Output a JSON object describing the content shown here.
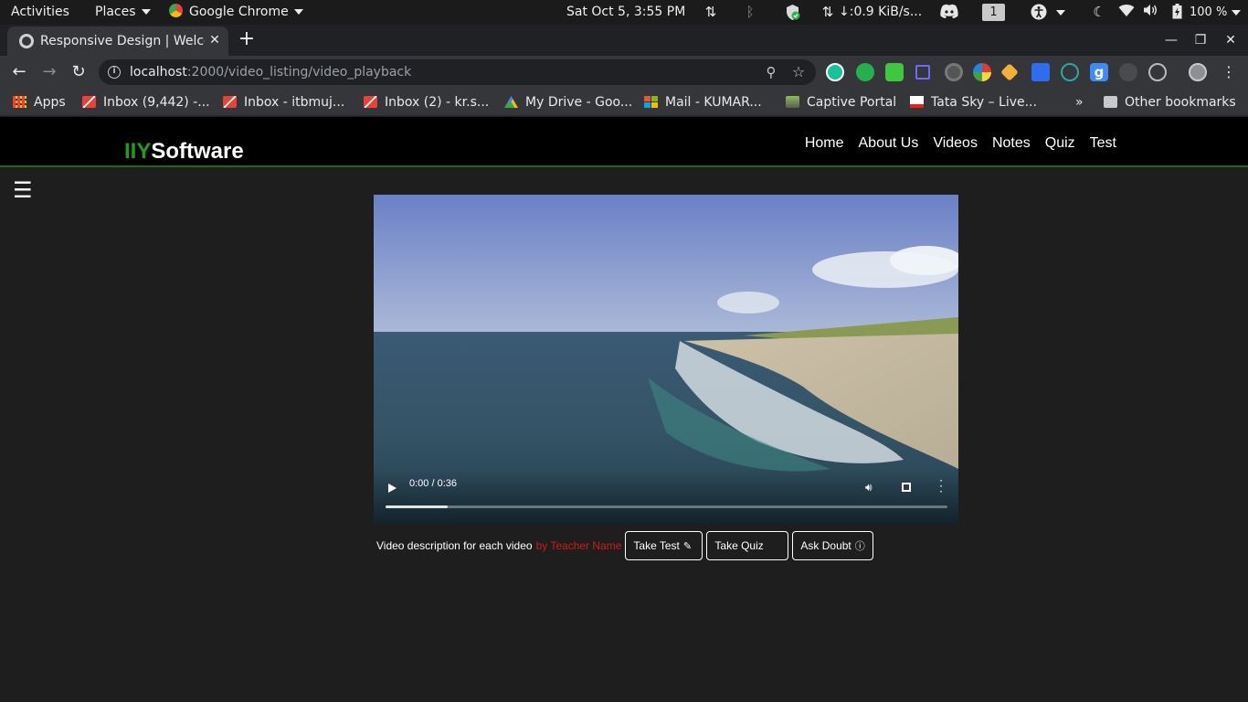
{
  "system_bar": {
    "activities": "Activities",
    "places": "Places",
    "app": "Google Chrome",
    "clock": "Sat Oct  5,  3:55 PM",
    "network_speed": "↓:0.9 KiB/s...",
    "workspace": "1",
    "battery": "100 %"
  },
  "browser": {
    "tab_title": "Responsive Design | Welcome",
    "url_host": "localhost",
    "url_path": ":2000/video_listing/video_playback",
    "bookmarks": [
      {
        "label": "Apps",
        "icon": "apps-grid-icon"
      },
      {
        "label": "Inbox (9,442) -...",
        "icon": "gmail-icon"
      },
      {
        "label": "Inbox - itbmuj...",
        "icon": "gmail-icon"
      },
      {
        "label": "Inbox (2) - kr.s...",
        "icon": "gmail-icon"
      },
      {
        "label": "My Drive - Goo...",
        "icon": "google-drive-icon"
      },
      {
        "label": "Mail - KUMAR...",
        "icon": "microsoft-icon"
      },
      {
        "label": "Captive Portal",
        "icon": "captive-portal-icon"
      },
      {
        "label": "Tata Sky – Live...",
        "icon": "tata-sky-icon"
      }
    ],
    "bookmarks_overflow": "»",
    "other_bookmarks": "Other bookmarks"
  },
  "site": {
    "brand_accent": "IIY",
    "brand_rest": "Software",
    "nav": [
      "Home",
      "About Us",
      "Videos",
      "Notes",
      "Quiz",
      "Test"
    ],
    "accent_color": "#1f9d1f"
  },
  "video": {
    "current_time": "0:00",
    "duration": "0:36",
    "time_display": "0:00 / 0:36",
    "buffered_fraction": 0.11
  },
  "details": {
    "description": "Video description for each video",
    "teacher": "by Teacher Name",
    "take_test": "Take Test",
    "take_quiz": "Take Quiz",
    "ask_doubt": "Ask Doubt"
  }
}
